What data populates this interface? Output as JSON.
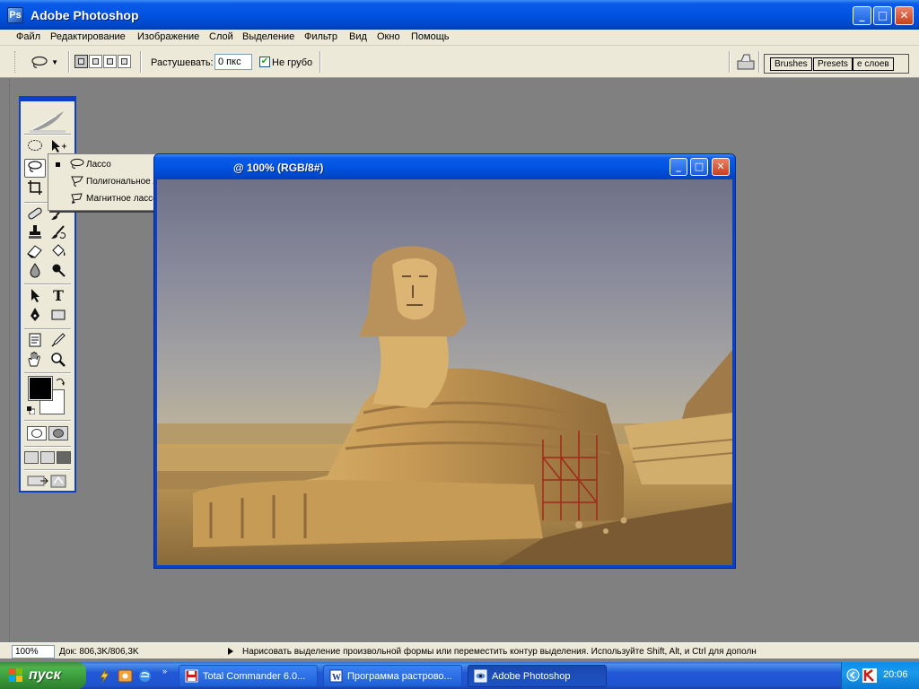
{
  "app": {
    "title": "Adobe Photoshop",
    "window_buttons": {
      "minimize": "_",
      "maximize": "□",
      "close": "✕"
    }
  },
  "menu": [
    "Файл",
    "Редактирование",
    "Изображение",
    "Слой",
    "Выделение",
    "Фильтр",
    "Вид",
    "Окно",
    "Помощь"
  ],
  "options": {
    "feather_label": "Растушевать:",
    "feather_value": "0 пкс",
    "antialias_label": "Не грубо",
    "antialias_checked": true,
    "selection_modes": [
      "new-selection",
      "add-to-selection",
      "subtract-from-selection",
      "intersect-selection"
    ]
  },
  "palette_well": {
    "tabs": [
      "Brushes",
      "Presets",
      "е слоев"
    ]
  },
  "flyout": {
    "items": [
      {
        "label": "Лассо",
        "key": "L",
        "selected": true
      },
      {
        "label": "Полигональное лассо",
        "key": "L",
        "selected": false
      },
      {
        "label": "Магнитное лассо",
        "key": "L",
        "selected": false
      }
    ]
  },
  "document": {
    "title": "@ 100% (RGB/8#)",
    "buttons": {
      "minimize": "_",
      "maximize": "□",
      "close": "✕"
    }
  },
  "toolbox": {
    "text_tool_glyph": "T",
    "foreground_color": "#000000",
    "background_color": "#ffffff"
  },
  "status": {
    "zoom": "100%",
    "doc_info": "Док: 806,3K/806,3K",
    "hint": "Нарисовать выделение произвольной формы или переместить контур выделения. Используйте Shift, Alt, и Ctrl для дополн"
  },
  "taskbar": {
    "start_label": "пуск",
    "tasks": [
      {
        "label": "Total Commander 6.0...",
        "active": false
      },
      {
        "label": "Программа растрово...",
        "active": false
      },
      {
        "label": "Adobe Photoshop",
        "active": true
      }
    ],
    "clock": "20:06"
  },
  "colors": {
    "xp_blue": "#0053e0",
    "workspace": "#808080",
    "panel": "#ece9d8",
    "start_green": "#3a9a3a"
  }
}
